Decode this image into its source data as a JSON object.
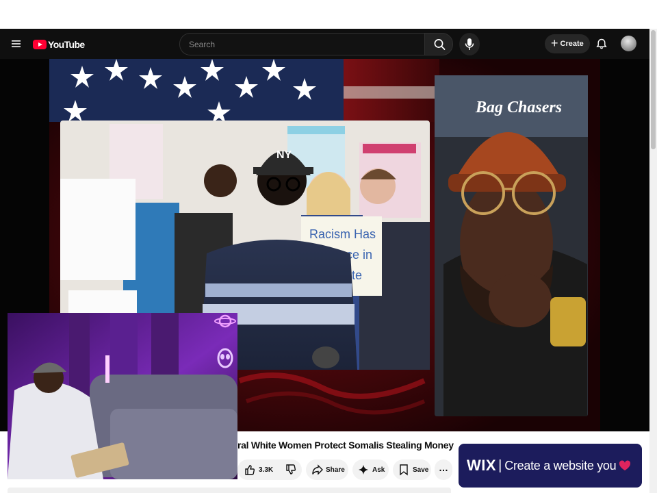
{
  "header": {
    "logo_text": "YouTube",
    "search_placeholder": "Search",
    "create_label": "Create",
    "icons": [
      "menu-icon",
      "youtube-logo-icon",
      "search-icon",
      "mic-icon",
      "plus-icon",
      "bell-icon",
      "avatar"
    ]
  },
  "video": {
    "title": "ral White Women Protect Somalis Stealing Money",
    "overlay_signs": [
      "Racism Has",
      "No Place in",
      "Our State"
    ],
    "cap_text": "Bag Chasers",
    "cap_logo": "NY"
  },
  "actions": {
    "like_count": "3.3K",
    "share_label": "Share",
    "ask_label": "Ask",
    "save_label": "Save",
    "more_label": "…"
  },
  "ad": {
    "brand": "WIX",
    "separator": "|",
    "text": "Create a website you",
    "heart_color": "#e0245e"
  },
  "colors": {
    "brand_red": "#ff0033",
    "masthead_bg": "#0f0f0f",
    "ad_bg": "#1c1c5c",
    "pip_glow": "#b030e0"
  }
}
